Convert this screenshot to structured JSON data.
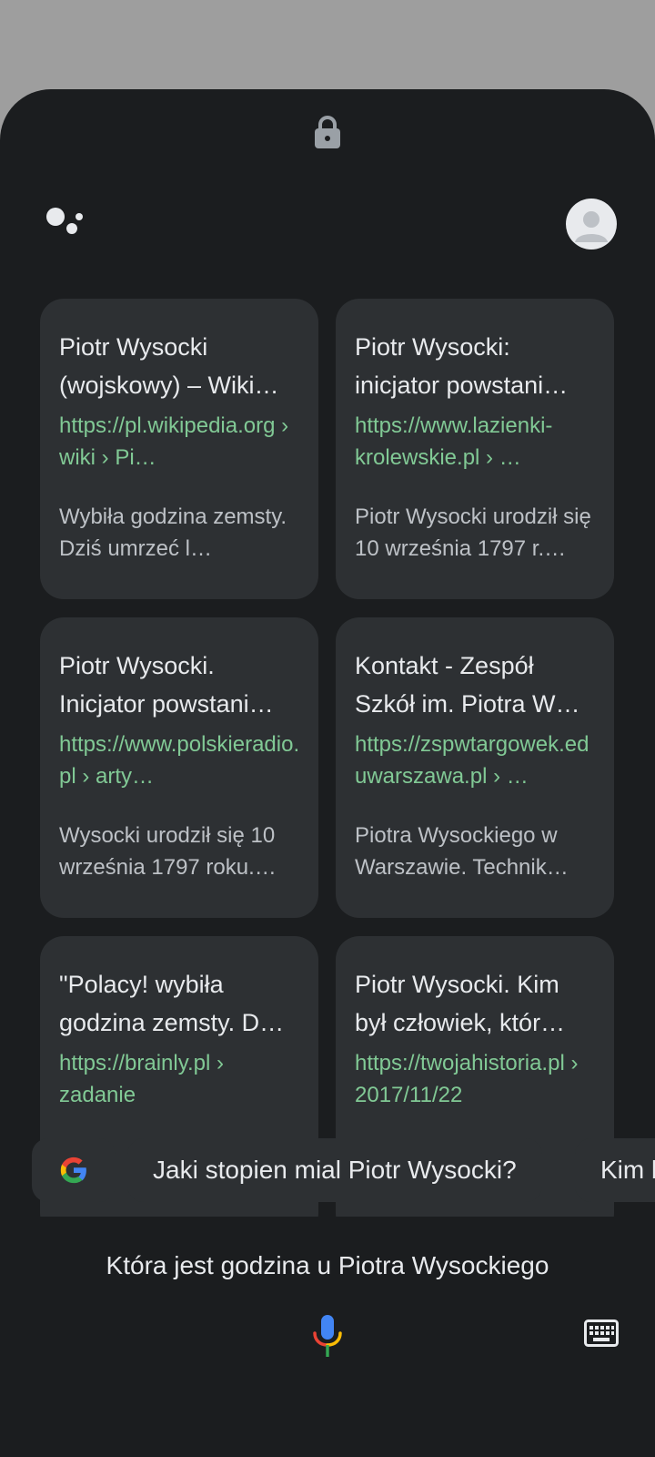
{
  "icons": {
    "lock": "lock-icon",
    "assistant": "google-assistant-icon",
    "avatar": "account-avatar-icon",
    "google": "google-g-icon",
    "mic": "microphone-icon",
    "keyboard": "keyboard-icon"
  },
  "colors": {
    "sheet_bg": "#1b1d1f",
    "card_bg": "#2d3033",
    "url_green": "#81c995",
    "title_text": "#e8eaed",
    "snippet_text": "#bdc1c6"
  },
  "results": [
    {
      "title": "Piotr Wysocki (wojskowy) – Wiki…",
      "url": "https://pl.wikipedia.org › wiki › Pi…",
      "snippet": "Wybiła godzina zemsty. Dziś umrzeć l…"
    },
    {
      "title": "Piotr Wysocki: inicjator powstani…",
      "url": "https://www.lazienki-krolewskie.pl › …",
      "snippet": "Piotr Wysocki urodził się 10 września 1797 r.…"
    },
    {
      "title": "Piotr Wysocki. Inicjator powstani…",
      "url": "https://www.polskieradio.pl › arty…",
      "snippet": "Wysocki urodził się 10 września 1797 roku.…"
    },
    {
      "title": "Kontakt - Zespół Szkół im. Piotra W…",
      "url": "https://zspwtargowek.eduwarszawa.pl › …",
      "snippet": "Piotra Wysockiego w Warszawie. Technik…"
    },
    {
      "title": "\"Polacy! wybiła godzina zemsty. D…",
      "url": "https://brainly.pl › zadanie",
      "snippet": ""
    },
    {
      "title": "Piotr Wysocki. Kim był człowiek, któr…",
      "url": "https://twojahistoria.pl › 2017/11/22",
      "snippet": ""
    }
  ],
  "suggestions": [
    "Jaki stopien mial Piotr Wysocki?",
    "Kim był Piotr Wysocki?"
  ],
  "query": "Która jest godzina u Piotra Wysockiego"
}
